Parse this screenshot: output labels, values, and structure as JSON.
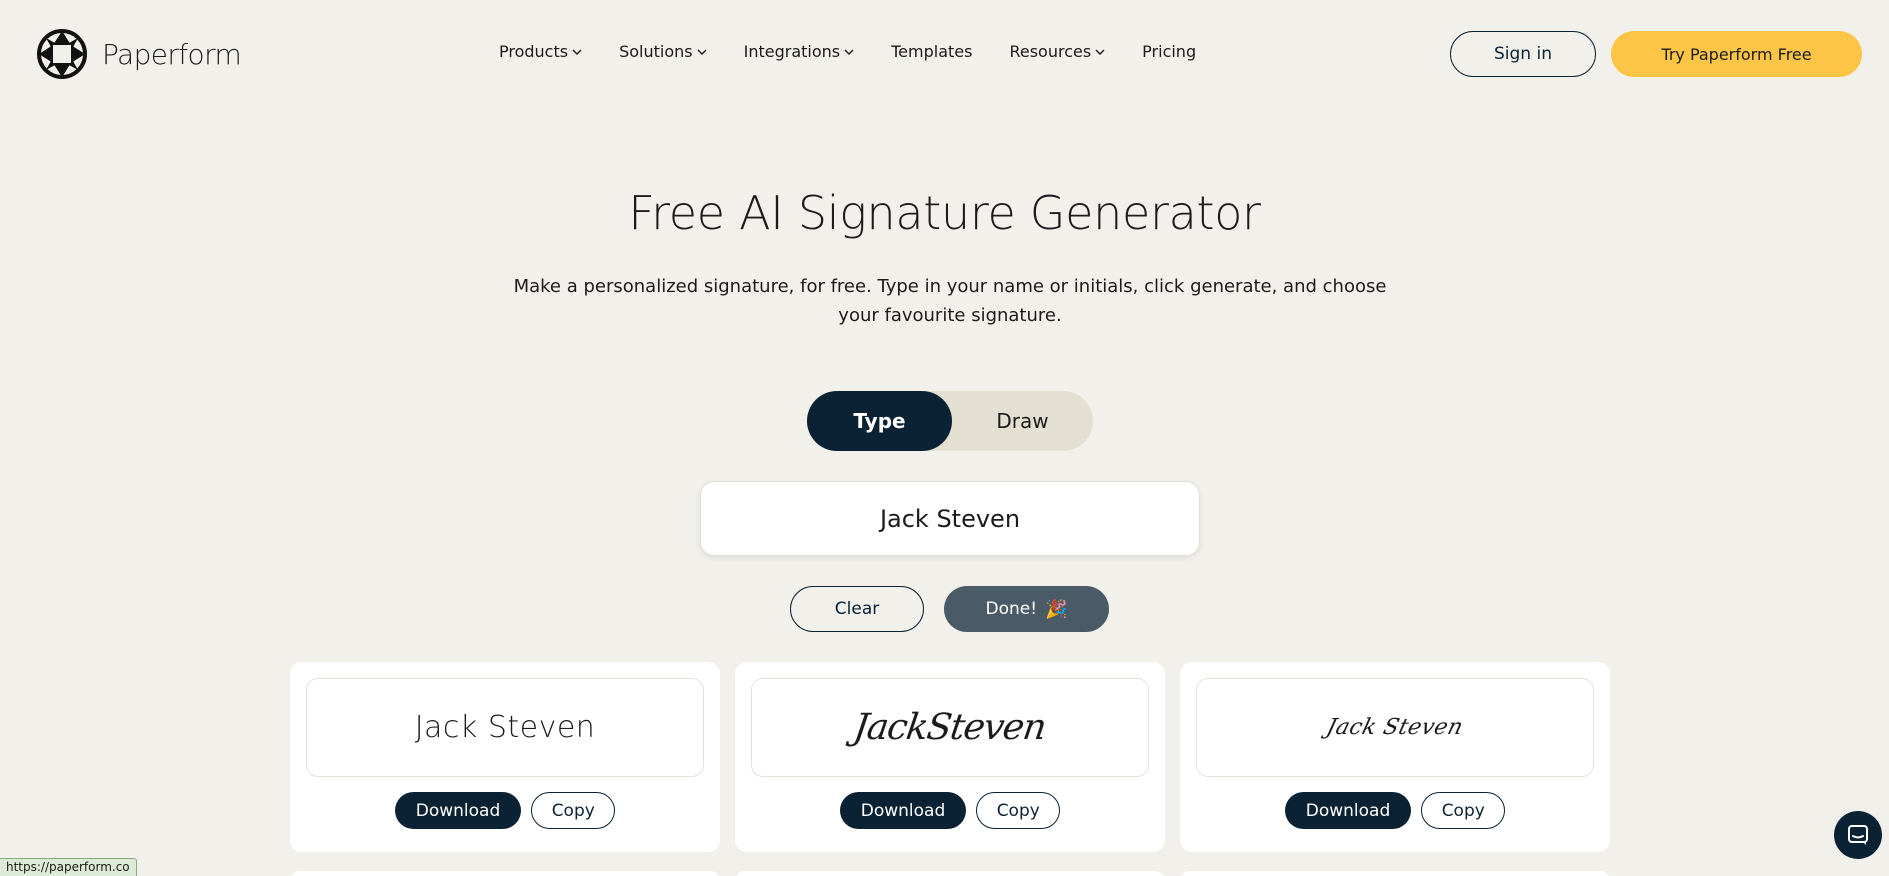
{
  "brand": {
    "name": "Paperform"
  },
  "nav": {
    "items": [
      {
        "label": "Products",
        "has_dropdown": true
      },
      {
        "label": "Solutions",
        "has_dropdown": true
      },
      {
        "label": "Integrations",
        "has_dropdown": true
      },
      {
        "label": "Templates",
        "has_dropdown": false
      },
      {
        "label": "Resources",
        "has_dropdown": true
      },
      {
        "label": "Pricing",
        "has_dropdown": false
      }
    ],
    "sign_in": "Sign in",
    "cta": "Try Paperform Free"
  },
  "hero": {
    "title": "Free AI Signature Generator",
    "subtitle": "Make a personalized signature, for free. Type in your name or initials, click generate, and choose your favourite signature."
  },
  "mode_tabs": {
    "type": "Type",
    "draw": "Draw",
    "active": "Type"
  },
  "name_input": {
    "value": "Jack Steven"
  },
  "actions": {
    "clear": "Clear",
    "done": "Done!",
    "done_emoji": "🎉"
  },
  "signatures": [
    {
      "text": "Jack Steven",
      "style": "sans-light",
      "download": "Download",
      "copy": "Copy"
    },
    {
      "text": "JackSteven",
      "style": "script-bold",
      "download": "Download",
      "copy": "Copy"
    },
    {
      "text": "Jack Steven",
      "style": "script-thin",
      "download": "Download",
      "copy": "Copy"
    }
  ],
  "status_bar": {
    "url": "https://paperform.co"
  },
  "colors": {
    "background": "#f2f0ea",
    "navy": "#0b2234",
    "accent_yellow": "#fdc545",
    "done_button": "#4a5a66",
    "tab_track": "#e3dfd1"
  },
  "icons": {
    "logo": "paperform-logo-icon",
    "dropdown": "chevron-down-icon",
    "chat": "chat-bubble-icon"
  }
}
